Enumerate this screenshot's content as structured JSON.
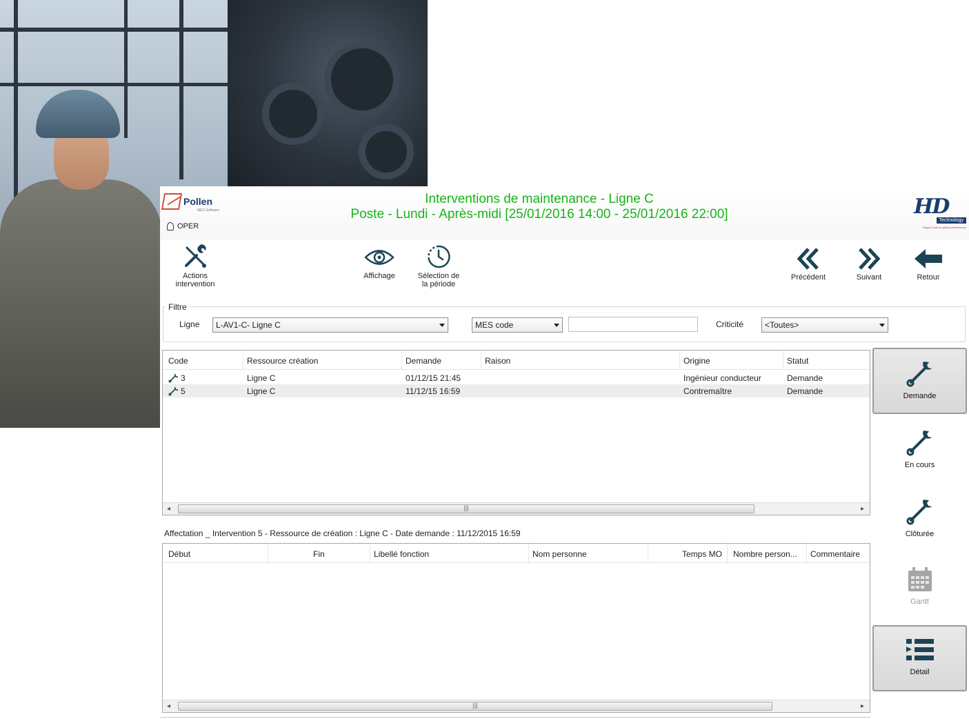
{
  "app": {
    "brand": "Pollen",
    "brand_sub": "MES Software",
    "user": "OPER",
    "title_line1": "Interventions de maintenance - Ligne C",
    "title_line2": "Poste - Lundi - Après-midi [25/01/2016 14:00 - 25/01/2016 22:00]",
    "partner_logo": "HD",
    "partner_sub": "Technology",
    "partner_tag": "Happy Code for global performance"
  },
  "toolbar": {
    "actions_line1": "Actions",
    "actions_line2": "intervention",
    "affichage": "Affichage",
    "selection_line1": "Sélection de",
    "selection_line2": "la période",
    "precedent": "Précédent",
    "suivant": "Suivant",
    "retour": "Retour"
  },
  "filter": {
    "legend": "Filtre",
    "ligne_label": "Ligne",
    "ligne_value": "L-AV1-C- Ligne C",
    "code_type_value": "MES code",
    "code_input_value": "",
    "criticite_label": "Criticité",
    "criticite_value": "<Toutes>"
  },
  "interventions": {
    "columns": [
      "Code",
      "Ressource création",
      "Demande",
      "Raison",
      "Origine",
      "Statut"
    ],
    "rows": [
      {
        "code": "3",
        "ressource": "Ligne C",
        "demande": "01/12/15 21:45",
        "raison": "",
        "origine": "Ingénieur conducteur",
        "statut": "Demande"
      },
      {
        "code": "5",
        "ressource": "Ligne C",
        "demande": "11/12/15 16:59",
        "raison": "",
        "origine": "Contremaître",
        "statut": "Demande"
      }
    ]
  },
  "affectation": {
    "caption": "Affectation _ Intervention 5 - Ressource de création : Ligne C - Date demande : 11/12/2015 16:59",
    "columns": [
      "Début",
      "Fin",
      "Libellé fonction",
      "Nom personne",
      "Temps MO",
      "Nombre person...",
      "Commentaire"
    ]
  },
  "sidebar": {
    "demande": "Demande",
    "en_cours": "En cours",
    "cloturee": "Clôturée",
    "gantt": "Gantt",
    "detail": "Détail"
  },
  "colors": {
    "title_green": "#18b318",
    "icon_dark": "#1c4455",
    "brand_blue": "#1a3d6e"
  }
}
